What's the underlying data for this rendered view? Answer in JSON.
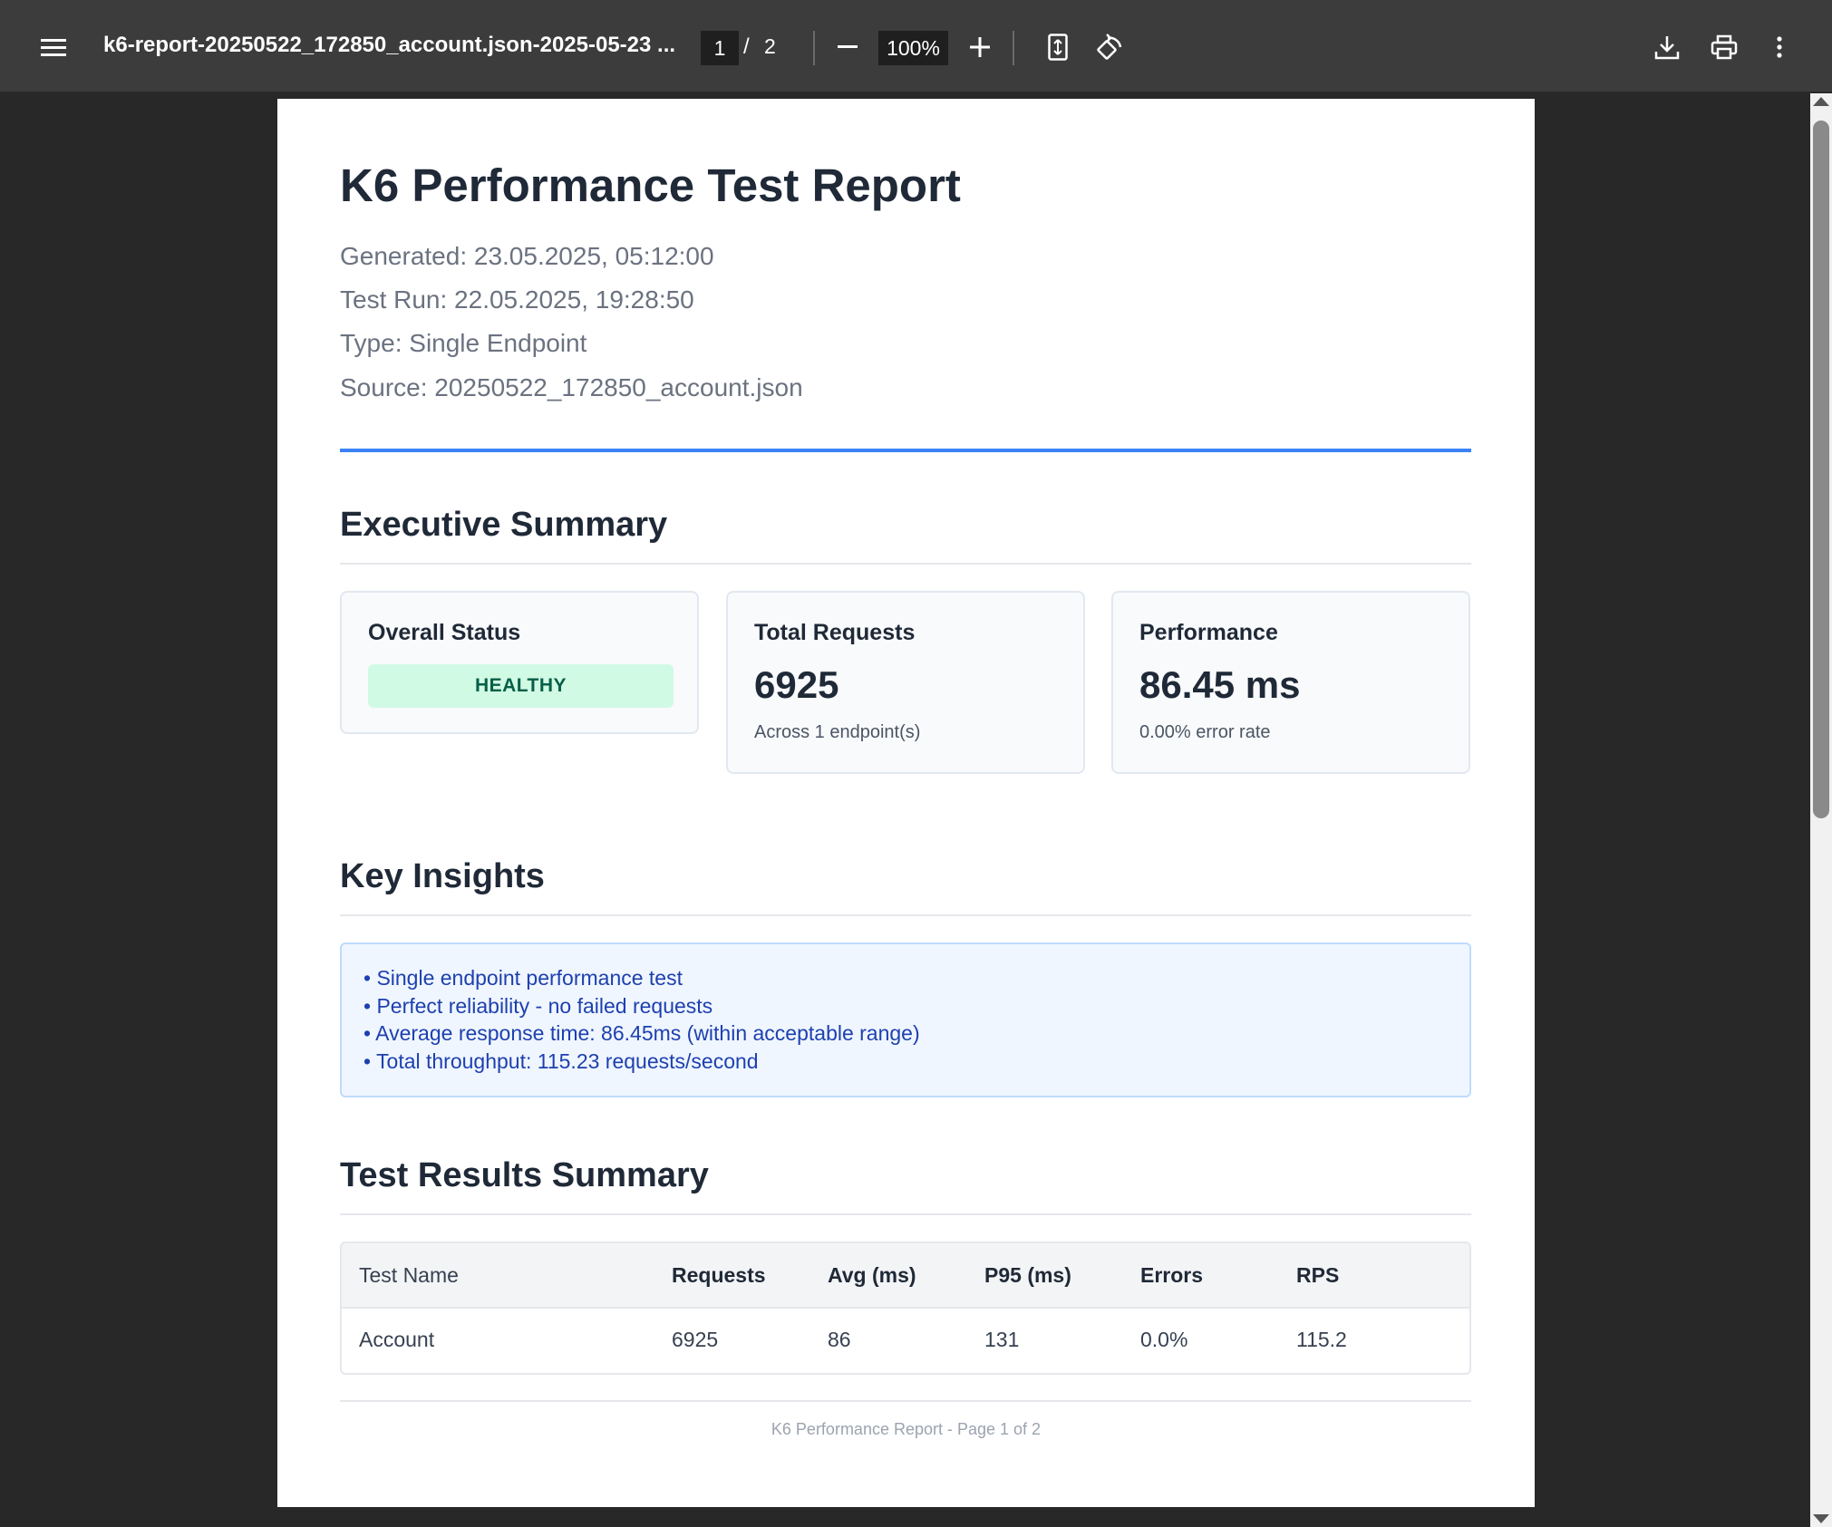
{
  "toolbar": {
    "title": "k6-report-20250522_172850_account.json-2025-05-23 ...",
    "page_current": "1",
    "page_separator": "/",
    "page_total": "2",
    "zoom": "100%"
  },
  "report": {
    "title": "K6 Performance Test Report",
    "generated": "Generated: 23.05.2025, 05:12:00",
    "test_run": "Test Run: 22.05.2025, 19:28:50",
    "type": "Type: Single Endpoint",
    "source": "Source: 20250522_172850_account.json"
  },
  "executive_summary": {
    "title": "Executive Summary",
    "overall_status": {
      "label": "Overall Status",
      "badge": "HEALTHY"
    },
    "total_requests": {
      "label": "Total Requests",
      "value": "6925",
      "sub": "Across 1 endpoint(s)"
    },
    "performance": {
      "label": "Performance",
      "value": "86.45 ms",
      "sub": "0.00% error rate"
    }
  },
  "key_insights": {
    "title": "Key Insights",
    "items": [
      "• Single endpoint performance test",
      "• Perfect reliability - no failed requests",
      "• Average response time: 86.45ms (within acceptable range)",
      "• Total throughput: 115.23 requests/second"
    ]
  },
  "test_results": {
    "title": "Test Results Summary",
    "headers": [
      "Test Name",
      "Requests",
      "Avg (ms)",
      "P95 (ms)",
      "Errors",
      "RPS"
    ],
    "rows": [
      [
        "Account",
        "6925",
        "86",
        "131",
        "0.0%",
        "115.2"
      ]
    ]
  },
  "footer": "K6 Performance Report - Page 1 of 2"
}
